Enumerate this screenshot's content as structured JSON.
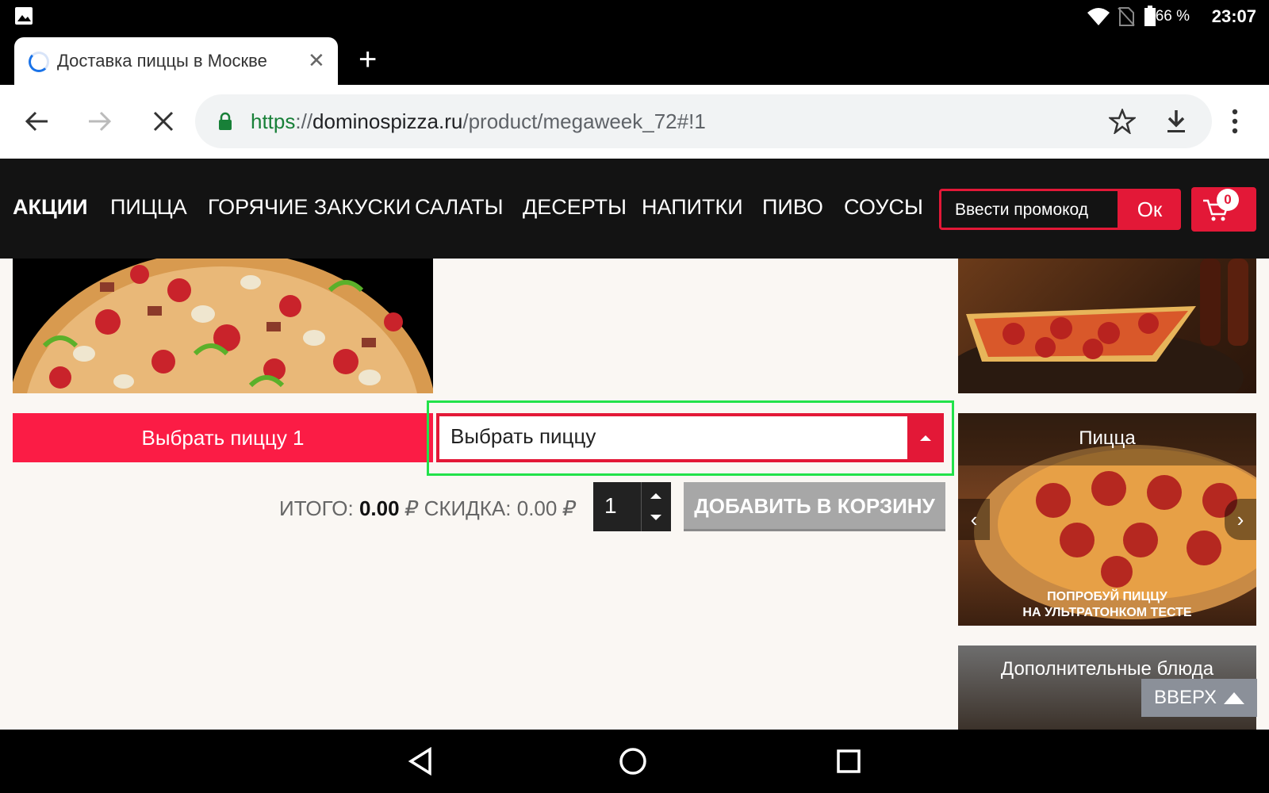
{
  "status": {
    "battery": "66 %",
    "time": "23:07"
  },
  "browser": {
    "tab_title": "Доставка пиццы в Москве",
    "url_scheme": "https",
    "url_sep": "://",
    "url_host": "dominospizza.ru",
    "url_path": "/product/megaweek_72#!1"
  },
  "nav": {
    "items": [
      "АКЦИИ",
      "ПИЦЦА",
      "ГОРЯЧИЕ ЗАКУСКИ",
      "САЛАТЫ",
      "ДЕСЕРТЫ",
      "НАПИТКИ",
      "ПИВО",
      "СОУСЫ"
    ],
    "promo_placeholder": "Ввести промокод",
    "promo_ok": "Ок",
    "cart_count": "0"
  },
  "product": {
    "choose_label": "Выбрать пиццу 1",
    "select_value": "Выбрать пиццу",
    "total_label": "ИТОГО:",
    "total_value": "0.00",
    "discount_label": "СКИДКА:",
    "discount_value": "0.00",
    "currency": "₽",
    "quantity": "1",
    "add_to_cart": "ДОБАВИТЬ В КОРЗИНУ"
  },
  "sidebar": {
    "card2_title": "Пицца",
    "card2_promo_line1": "ПОПРОБУЙ ПИЦЦУ",
    "card2_promo_line2": "НА УЛЬТРАТОНКОМ ТЕСТЕ",
    "card3_title": "Дополнительные блюда",
    "to_top": "ВВЕРХ"
  },
  "colors": {
    "brand_red": "#e31837",
    "focus_green": "#22e24a"
  }
}
